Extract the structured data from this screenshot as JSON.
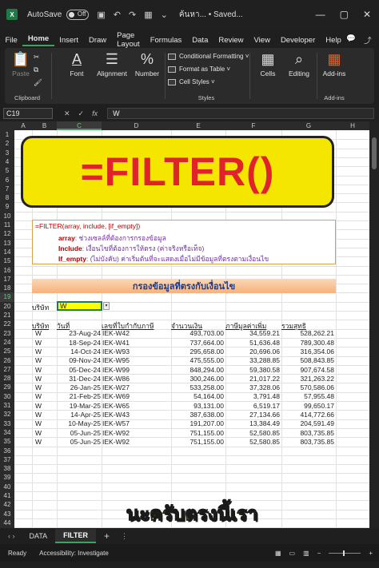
{
  "titlebar": {
    "app_icon": "X",
    "autosave_label": "AutoSave",
    "toggle_state": "Off",
    "doc_title": "ค้นหา... • Saved...",
    "icons": [
      "save-icon",
      "undo-icon",
      "redo-icon",
      "table-icon",
      "more-icon"
    ],
    "window_controls": [
      "—",
      "▢",
      "✕"
    ]
  },
  "menu": {
    "items": [
      "File",
      "Home",
      "Insert",
      "Draw",
      "Page Layout",
      "Formulas",
      "Data",
      "Review",
      "View",
      "Developer",
      "Help"
    ],
    "active": "Home",
    "right_icons": [
      "💬",
      "⤴"
    ]
  },
  "ribbon": {
    "paste_label": "Paste",
    "clipboard_label": "Clipboard",
    "font_label": "Font",
    "alignment_label": "Alignment",
    "number_label": "Number",
    "conditional_formatting": "Conditional Formatting ˅",
    "format_as_table": "Format as Table ˅",
    "cell_styles": "Cell Styles ˅",
    "styles_label": "Styles",
    "cells_label": "Cells",
    "editing_label": "Editing",
    "addins_label": "Add-ins",
    "addins_group_label": "Add-ins"
  },
  "formula_bar": {
    "name_box": "C19",
    "fx_symbols": [
      "✕",
      "✓",
      "fx"
    ],
    "content": "W"
  },
  "grid": {
    "columns": [
      "A",
      "B",
      "C",
      "D",
      "E",
      "F",
      "G",
      "H"
    ],
    "selected_column": "C",
    "rows": [
      "1",
      "2",
      "3",
      "4",
      "5",
      "6",
      "7",
      "8",
      "9",
      "10",
      "11",
      "12",
      "13",
      "14",
      "15",
      "16",
      "17",
      "18",
      "19",
      "20",
      "21",
      "22",
      "23",
      "24",
      "25",
      "26",
      "27",
      "28",
      "29",
      "30",
      "31",
      "32",
      "33",
      "34",
      "35",
      "36",
      "37",
      "38",
      "39",
      "40",
      "41",
      "42",
      "43",
      "44"
    ],
    "selected_row": "19"
  },
  "banner": {
    "text": "=FILTER()"
  },
  "syntax": {
    "line1": "=FILTER(array, include, [if_empty])",
    "array_key": "array",
    "array_desc": ": ช่วงเซลล์ที่ต้องการกรองข้อมูล",
    "include_key": "Include",
    "include_desc": ": เงื่อนไขที่ต้องการให้ตรง (ค่าจริงหรือเท็จ)",
    "ifempty_key": "If_empty",
    "ifempty_desc": ": (ไม่บังคับ) ค่าเริ่มต้นที่จะแสดงเมื่อไม่มีข้อมูลที่ตรงตามเงื่อนไข"
  },
  "header_bar": {
    "text": "กรองข้อมูลที่ตรงกับเงื่อนไข"
  },
  "filter": {
    "label": "บริษัท",
    "value": "W",
    "dropdown": "▾"
  },
  "table": {
    "headers": [
      "บริษัท",
      "วันที่",
      "เลขที่ใบกำกับภาษี",
      "จำนวนเงิน",
      "ภาษีมูลค่าเพิ่ม",
      "รวมสุทธิ"
    ],
    "rows": [
      [
        "W",
        "23-Aug-24",
        "IEK-W42",
        "493,703.00",
        "34,559.21",
        "528,262.21"
      ],
      [
        "W",
        "18-Sep-24",
        "IEK-W41",
        "737,664.00",
        "51,636.48",
        "789,300.48"
      ],
      [
        "W",
        "14-Oct-24",
        "IEK-W93",
        "295,658.00",
        "20,696.06",
        "316,354.06"
      ],
      [
        "W",
        "09-Nov-24",
        "IEK-W95",
        "475,555.00",
        "33,288.85",
        "508,843.85"
      ],
      [
        "W",
        "05-Dec-24",
        "IEK-W99",
        "848,294.00",
        "59,380.58",
        "907,674.58"
      ],
      [
        "W",
        "31-Dec-24",
        "IEK-W86",
        "300,246.00",
        "21,017.22",
        "321,263.22"
      ],
      [
        "W",
        "26-Jan-25",
        "IEK-W27",
        "533,258.00",
        "37,328.06",
        "570,586.06"
      ],
      [
        "W",
        "21-Feb-25",
        "IEK-W69",
        "54,164.00",
        "3,791.48",
        "57,955.48"
      ],
      [
        "W",
        "19-Mar-25",
        "IEK-W65",
        "93,131.00",
        "6,519.17",
        "99,650.17"
      ],
      [
        "W",
        "14-Apr-25",
        "IEK-W43",
        "387,638.00",
        "27,134.66",
        "414,772.66"
      ],
      [
        "W",
        "10-May-25",
        "IEK-W57",
        "191,207.00",
        "13,384.49",
        "204,591.49"
      ],
      [
        "W",
        "05-Jun-25",
        "IEK-W92",
        "751,155.00",
        "52,580.85",
        "803,735.85"
      ],
      [
        "W",
        "05-Jun-25",
        "IEK-W92",
        "751,155.00",
        "52,580.85",
        "803,735.85"
      ]
    ]
  },
  "caption": {
    "text": "นะครับตรงนี้เรา"
  },
  "tabs": {
    "nav": "‹   ›",
    "sheets": [
      "DATA",
      "FILTER"
    ],
    "active": "FILTER",
    "add": "+"
  },
  "status": {
    "ready": "Ready",
    "accessibility": "Accessibility: Investigate",
    "zoom": "+"
  }
}
